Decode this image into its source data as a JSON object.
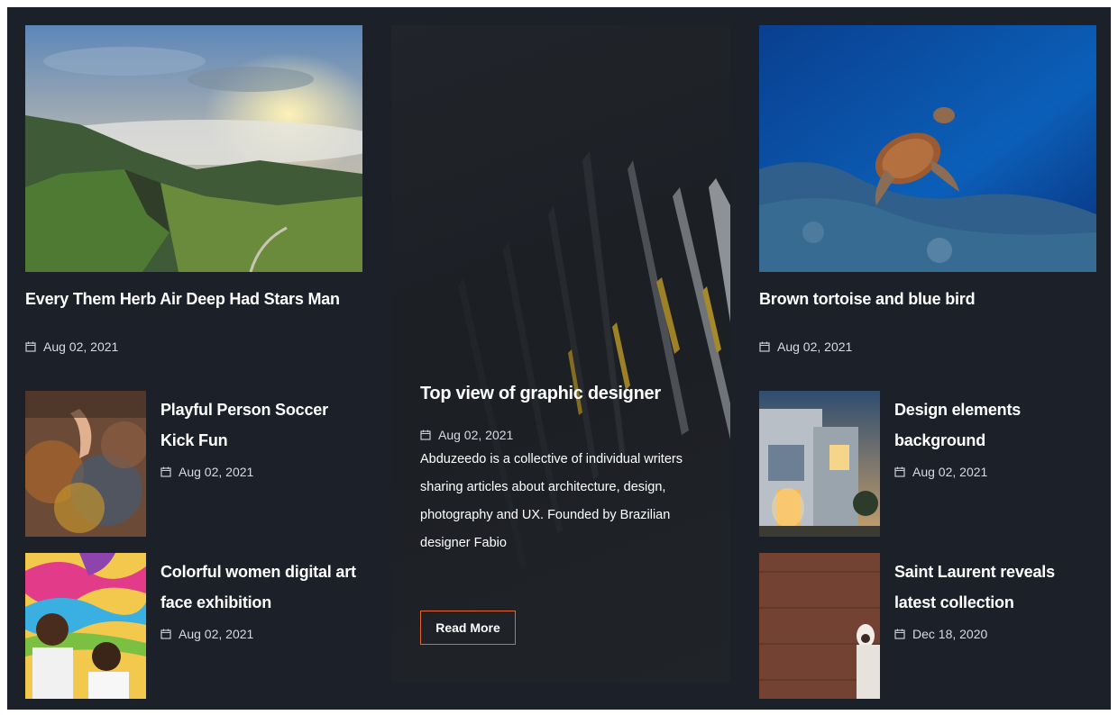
{
  "colors": {
    "background": "#1b2029",
    "accent": "#e8642c",
    "text": "#ffffff"
  },
  "posts": {
    "left_main": {
      "title": "Every Them Herb Air Deep Had Stars Man",
      "date": "Aug 02, 2021"
    },
    "left_small": [
      {
        "title": "Playful Person Soccer Kick Fun",
        "date": "Aug 02, 2021"
      },
      {
        "title": "Colorful women digital art face exhibition",
        "date": "Aug 02, 2021"
      }
    ],
    "feature": {
      "title": "Top view of graphic designer",
      "date": "Aug 02, 2021",
      "description": "Abduzeedo is a collective of individual writers sharing articles about architecture, design, photography and UX. Founded by Brazilian designer Fabio",
      "button": "Read More"
    },
    "right_main": {
      "title": "Brown tortoise and blue bird",
      "date": "Aug 02, 2021"
    },
    "right_small": [
      {
        "title": "Design elements background",
        "date": "Aug 02, 2021"
      },
      {
        "title": "Saint Laurent reveals latest collection",
        "date": "Dec 18, 2020"
      }
    ]
  },
  "icons": {
    "date": "calendar-icon"
  }
}
